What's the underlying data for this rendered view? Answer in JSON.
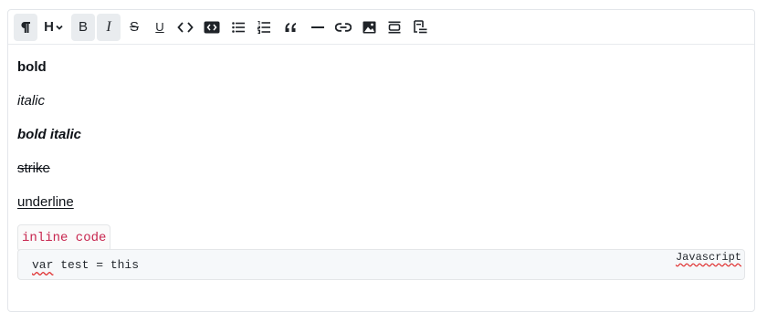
{
  "toolbar": {
    "items": [
      {
        "name": "paragraph",
        "icon": "pilcrow-icon",
        "active": true
      },
      {
        "name": "heading",
        "icon": "heading-icon",
        "glyph": "H",
        "active": false
      },
      {
        "name": "bold",
        "icon": "bold-icon",
        "glyph": "B",
        "active": true
      },
      {
        "name": "italic",
        "icon": "italic-icon",
        "glyph": "I",
        "active": true
      },
      {
        "name": "strikethrough",
        "icon": "strikethrough-icon",
        "glyph": "S",
        "active": false
      },
      {
        "name": "underline",
        "icon": "underline-icon",
        "glyph": "U",
        "active": false
      },
      {
        "name": "inline-code",
        "icon": "code-brackets-icon",
        "active": false
      },
      {
        "name": "code-block",
        "icon": "code-block-icon",
        "active": false
      },
      {
        "name": "bullet-list",
        "icon": "bullet-list-icon",
        "active": false
      },
      {
        "name": "ordered-list",
        "icon": "ordered-list-icon",
        "active": false
      },
      {
        "name": "blockquote",
        "icon": "quote-icon",
        "active": false
      },
      {
        "name": "horizontal-rule",
        "icon": "horizontal-rule-icon",
        "active": false
      },
      {
        "name": "link",
        "icon": "link-icon",
        "active": false
      },
      {
        "name": "image",
        "icon": "image-icon",
        "active": false
      },
      {
        "name": "embed",
        "icon": "embed-icon",
        "active": false
      },
      {
        "name": "toc",
        "icon": "toc-icon",
        "active": false
      }
    ]
  },
  "content": {
    "bold": "bold",
    "italic": "italic",
    "bold_italic": "bold italic",
    "strike": "strike",
    "underline": "underline",
    "inline_code": "inline code",
    "code_block": {
      "keyword": "var",
      "rest": " test = this",
      "language": "Javascript"
    }
  },
  "colors": {
    "inline_code_text": "#c7254e",
    "active_button_bg": "#e9ecef",
    "spellcheck_underline": "#e03131"
  }
}
